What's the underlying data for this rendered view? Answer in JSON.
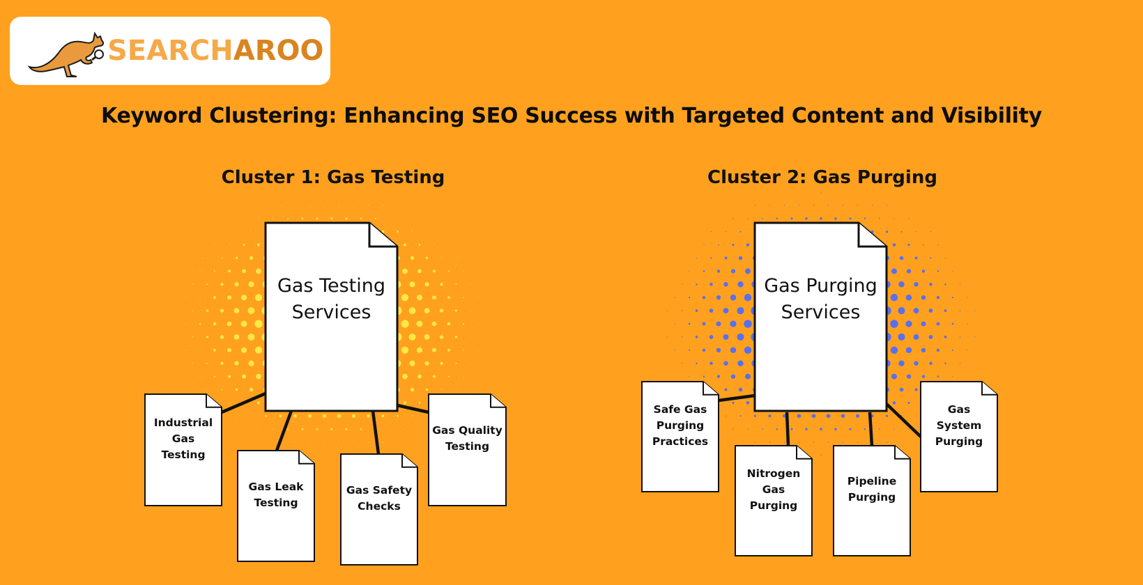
{
  "brand": {
    "name_part1": "SEARCH",
    "name_part2": "AROO",
    "logo_icon": "kangaroo-with-magnifier-icon",
    "color_part1": "#F5A948",
    "color_part2": "#D98420"
  },
  "title": "Keyword Clustering: Enhancing SEO Success with Targeted Content and Visibility",
  "colors": {
    "background": "#FFA11E",
    "cluster1_dots": "#FFE844",
    "cluster2_dots": "#5A6FF0",
    "document_fill": "#FFFFFF",
    "document_stroke": "#111111"
  },
  "clusters": [
    {
      "heading": "Cluster 1: Gas Testing",
      "pillar": "Gas Testing\nServices",
      "subtopics": [
        "Industrial\nGas\nTesting",
        "Gas Leak\nTesting",
        "Gas Safety\nChecks",
        "Gas Quality\nTesting"
      ]
    },
    {
      "heading": "Cluster 2: Gas Purging",
      "pillar": "Gas Purging\nServices",
      "subtopics": [
        "Safe Gas\nPurging\nPractices",
        "Nitrogen\nGas\nPurging",
        "Pipeline\nPurging",
        "Gas\nSystem\nPurging"
      ]
    }
  ]
}
